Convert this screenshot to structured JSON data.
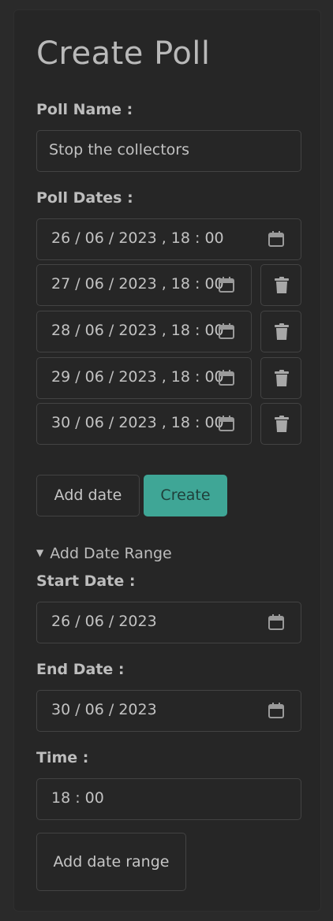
{
  "form": {
    "title": "Create Poll",
    "poll_name_label": "Poll Name :",
    "poll_name_value": "Stop the collectors",
    "poll_dates_label": "Poll Dates :",
    "dates": [
      {
        "value": "26 / 06 / 2023 ,  18 : 00",
        "removable": false
      },
      {
        "value": "27 / 06 / 2023 ,  18 : 00",
        "removable": true
      },
      {
        "value": "28 / 06 / 2023 ,  18 : 00",
        "removable": true
      },
      {
        "value": "29 / 06 / 2023 ,  18 : 00",
        "removable": true
      },
      {
        "value": "30 / 06 / 2023 ,  18 : 00",
        "removable": true
      }
    ],
    "add_date_label": "Add date",
    "create_label": "Create"
  },
  "date_range": {
    "summary": "Add Date Range",
    "expanded": true,
    "start_label": "Start Date :",
    "start_value": "26 / 06 / 2023",
    "end_label": "End Date :",
    "end_value": "30 / 06 / 2023",
    "time_label": "Time :",
    "time_value": "18 : 00",
    "add_range_label": "Add date range"
  },
  "icons": {
    "calendar": "calendar-icon",
    "trash": "trash-icon",
    "disclosure": "triangle-down-icon"
  },
  "colors": {
    "background": "#2a2a2a",
    "card": "#262626",
    "border": "#434343",
    "text": "#c2c2c2",
    "primary": "#3fa696"
  }
}
